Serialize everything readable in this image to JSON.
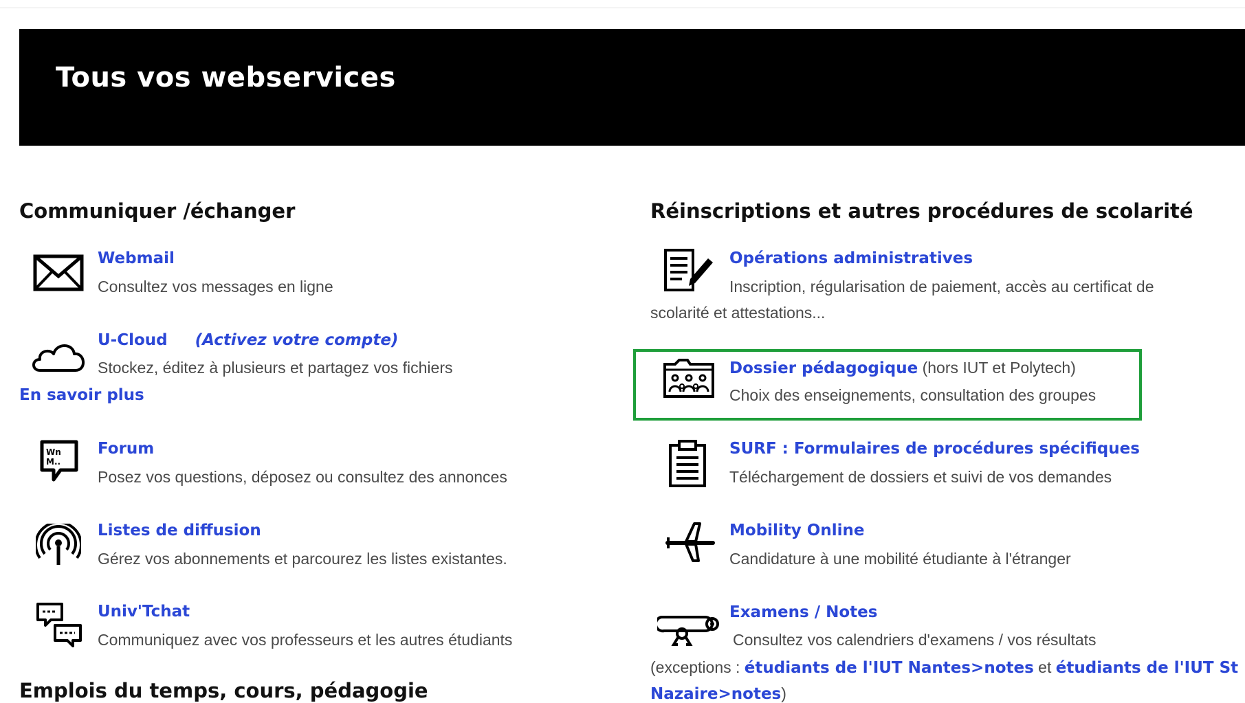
{
  "banner": {
    "title": "Tous vos webservices"
  },
  "left_section": {
    "title": "Communiquer /échanger",
    "items": [
      {
        "icon": "envelope-icon",
        "title": "Webmail",
        "desc": "Consultez vos messages en ligne"
      },
      {
        "icon": "cloud-icon",
        "title": "U-Cloud",
        "extra": "(Activez votre compte)",
        "desc": "Stockez, éditez à plusieurs et partagez vos fichiers",
        "more": "En savoir plus"
      },
      {
        "icon": "forum-icon",
        "title": "Forum",
        "desc": "Posez vos questions, déposez ou consultez des annonces"
      },
      {
        "icon": "broadcast-icon",
        "title": "Listes de diffusion",
        "desc": "Gérez vos abonnements et parcourez les listes existantes."
      },
      {
        "icon": "chat-icon",
        "title": "Univ'Tchat",
        "desc": "Communiquez avec vos professeurs et les autres étudiants"
      }
    ]
  },
  "left_section_2": {
    "title": "Emplois du temps, cours, pédagogie"
  },
  "right_section": {
    "title": "Réinscriptions et autres procédures de scolarité",
    "items": [
      {
        "icon": "document-edit-icon",
        "title": "Opérations administratives",
        "desc_line1": "Inscription, régularisation de paiement, accès au certificat de",
        "desc_line2": "scolarité et attestations..."
      },
      {
        "icon": "group-folder-icon",
        "title": "Dossier pédagogique",
        "note": " (hors IUT et Polytech)",
        "desc": "Choix des enseignements, consultation des groupes"
      },
      {
        "icon": "clipboard-icon",
        "title": "SURF : Formulaires de procédures spécifiques",
        "desc": "Téléchargement de dossiers et suivi de vos demandes"
      },
      {
        "icon": "airplane-icon",
        "title": "Mobility Online",
        "desc": "Candidature à une mobilité étudiante à l'étranger"
      },
      {
        "icon": "diploma-icon",
        "title": "Examens / Notes",
        "desc": "Consultez vos calendriers d'examens / vos résultats",
        "exceptions_prefix": "(exceptions : ",
        "link1": "étudiants de l'IUT Nantes>notes",
        "between": " et ",
        "link2_part1": "étudiants de l'IUT St",
        "link2_part2": "Nazaire>notes",
        "suffix": ")"
      }
    ]
  },
  "colors": {
    "link": "#2b47d6",
    "highlight_border": "#1e9e3a",
    "banner_bg": "#000000"
  }
}
